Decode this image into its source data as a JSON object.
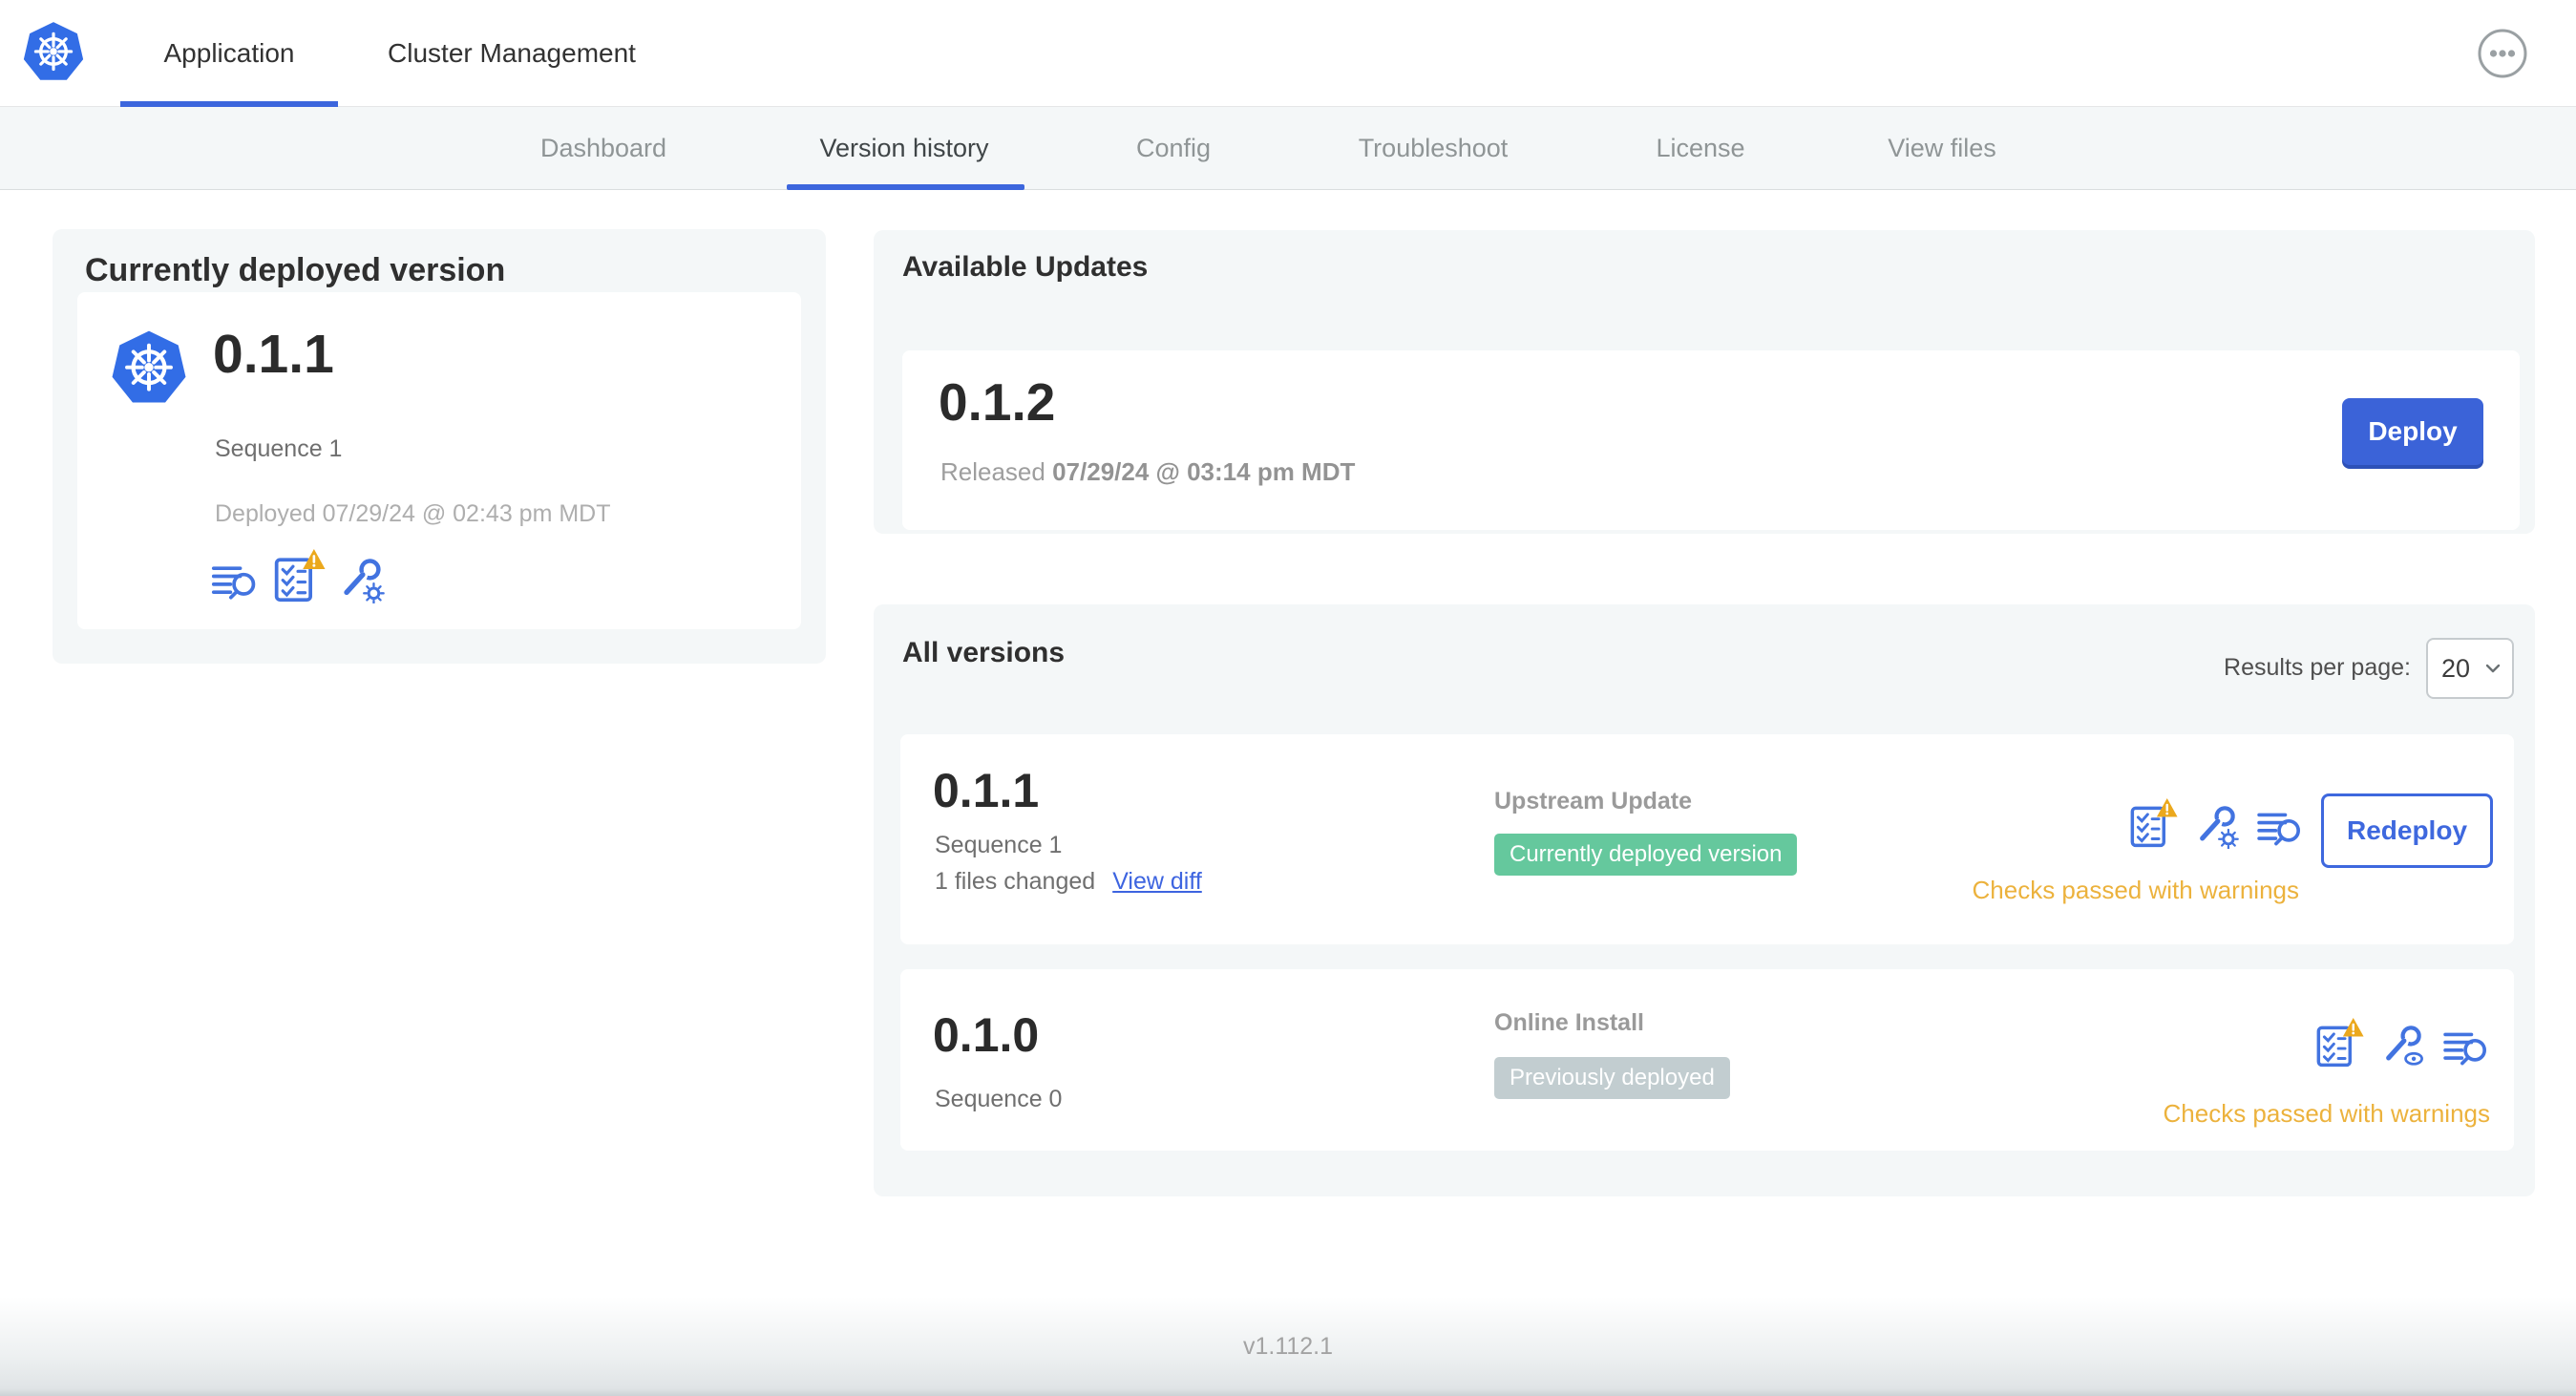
{
  "header": {
    "logo_icon": "kubernetes-logo",
    "application_tab": "Application",
    "cluster_tab": "Cluster Management",
    "menu_icon": "ellipsis-icon"
  },
  "subnav": {
    "active_tab": "Version history",
    "tabs": [
      {
        "label": "Dashboard"
      },
      {
        "label": "Version history"
      },
      {
        "label": "Config"
      },
      {
        "label": "Troubleshoot"
      },
      {
        "label": "License"
      },
      {
        "label": "View files"
      }
    ]
  },
  "current_version": {
    "title": "Currently deployed version",
    "version": "0.1.1",
    "sequence": "Sequence 1",
    "deployed": "Deployed 07/29/24 @ 02:43 pm MDT",
    "icons": [
      "deploy-logs-icon",
      "preflight-checks-warning-icon",
      "config-gear-icon"
    ]
  },
  "available_updates": {
    "title": "Available Updates",
    "version": "0.1.2",
    "released_label": "Released",
    "released_date": "07/29/24 @ 03:14 pm MDT",
    "deploy_button": "Deploy"
  },
  "all_versions": {
    "title": "All versions",
    "results_per_page_label": "Results per page:",
    "results_per_page_value": "20",
    "rows": [
      {
        "version": "0.1.1",
        "sequence": "Sequence 1",
        "files_changed": "1 files changed",
        "view_diff": "View diff",
        "source": "Upstream Update",
        "badge": "Currently deployed version",
        "badge_style": "green",
        "icons": [
          "preflight-checks-warning-icon",
          "config-gear-icon",
          "deploy-logs-icon"
        ],
        "action": "Redeploy",
        "status": "Checks passed with warnings"
      },
      {
        "version": "0.1.0",
        "sequence": "Sequence 0",
        "source": "Online Install",
        "badge": "Previously deployed",
        "badge_style": "gray",
        "icons": [
          "preflight-checks-warning-icon",
          "config-view-icon",
          "deploy-logs-icon"
        ],
        "status": "Checks passed with warnings"
      }
    ]
  },
  "footer": {
    "app_version": "v1.112.1"
  },
  "colors": {
    "primary_blue": "#3b63d8",
    "icon_blue": "#4273e0",
    "link_blue": "#3d64e0",
    "active_underline": "#3c66dd",
    "warning_amber": "#eba81d",
    "warning_text": "#ecb23d",
    "badge_green": "#65c89d",
    "badge_gray": "#c2cdd0",
    "card_gray": "#f4f7f8",
    "kubernetes_blue": "#326de6"
  }
}
